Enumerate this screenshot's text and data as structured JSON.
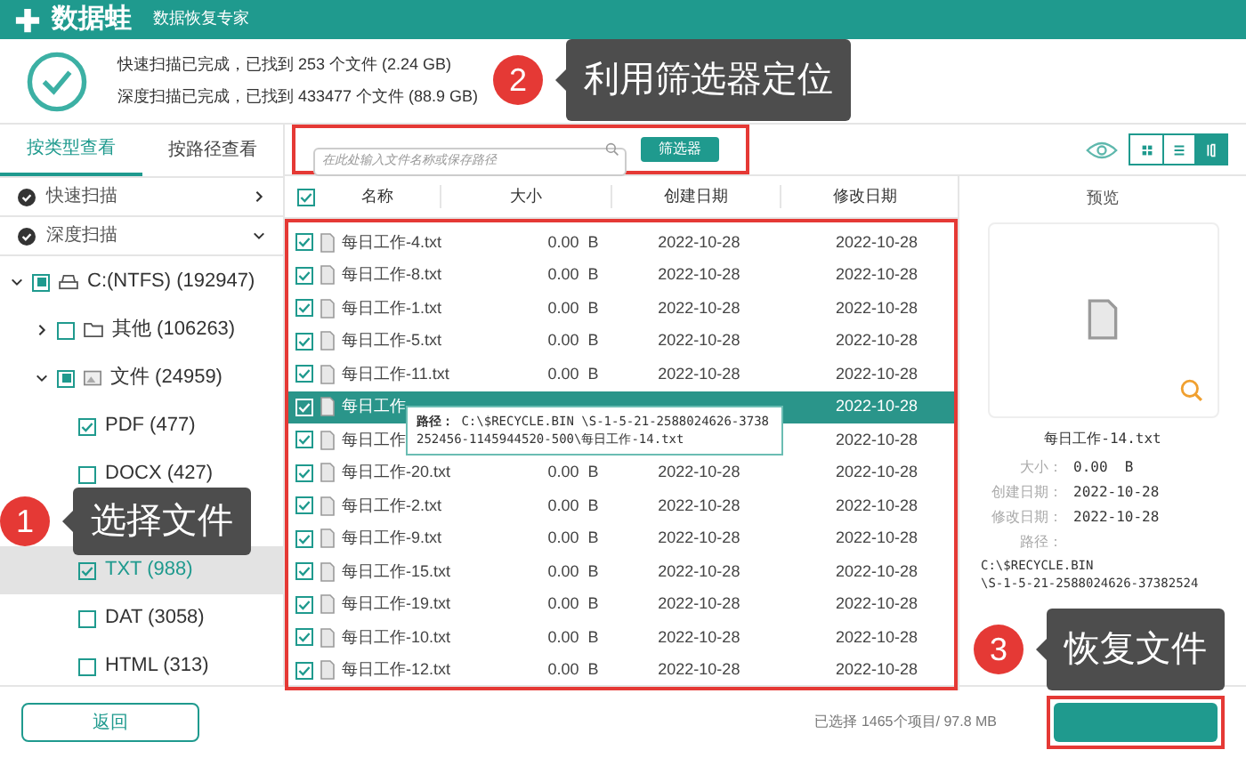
{
  "app": {
    "name": "数据蛙",
    "subtitle": "数据恢复专家"
  },
  "scan_summary": [
    "快速扫描已完成，已找到 253 个文件 (2.24 GB)",
    "深度扫描已完成，已找到 433477 个文件 (88.9 GB)"
  ],
  "view_tabs": [
    {
      "label": "按类型查看",
      "selected": true
    },
    {
      "label": "按路径查看",
      "selected": false
    }
  ],
  "scan_modes": [
    {
      "label": "快速扫描",
      "expanded": false
    },
    {
      "label": "深度扫描",
      "expanded": true
    }
  ],
  "tree": [
    {
      "label": "C:(NTFS) (192947)",
      "kind": "drive",
      "partial": true,
      "expanded": true,
      "selected": false,
      "children": [
        {
          "label": "其他 (106263)",
          "kind": "folder",
          "checked": false,
          "expanded": false,
          "selected": false
        },
        {
          "label": "文件 (24959)",
          "kind": "files",
          "partial": true,
          "expanded": true,
          "selected": false,
          "children": [
            {
              "label": "PDF (477)",
              "checked": true,
              "selected": false
            },
            {
              "label": "DOCX (427)",
              "checked": false,
              "selected": false
            },
            {
              "selected": false
            },
            {
              "label": "TXT (988)",
              "checked": true,
              "selected": true
            },
            {
              "label": "DAT (3058)",
              "checked": false,
              "selected": false
            },
            {
              "label": "HTML (313)",
              "checked": false,
              "selected": false
            }
          ]
        }
      ]
    }
  ],
  "search": {
    "placeholder": "在此处输入文件名称或保存路径"
  },
  "filter_button": "筛选器",
  "view_modes": [
    {
      "kind": "grid",
      "selected": false
    },
    {
      "kind": "list",
      "selected": false
    },
    {
      "kind": "detail",
      "selected": true
    }
  ],
  "table": {
    "all_checked": true,
    "columns": [
      "名称",
      "大小",
      "创建日期",
      "修改日期"
    ],
    "rows": [
      {
        "name": "每日工作-4.txt",
        "size": "0.00  B",
        "created": "2022-10-28",
        "modified": "2022-10-28",
        "checked": true,
        "selected": false
      },
      {
        "name": "每日工作-8.txt",
        "size": "0.00  B",
        "created": "2022-10-28",
        "modified": "2022-10-28",
        "checked": true,
        "selected": false
      },
      {
        "name": "每日工作-1.txt",
        "size": "0.00  B",
        "created": "2022-10-28",
        "modified": "2022-10-28",
        "checked": true,
        "selected": false
      },
      {
        "name": "每日工作-5.txt",
        "size": "0.00  B",
        "created": "2022-10-28",
        "modified": "2022-10-28",
        "checked": true,
        "selected": false
      },
      {
        "name": "每日工作-11.txt",
        "size": "0.00  B",
        "created": "2022-10-28",
        "modified": "2022-10-28",
        "checked": true,
        "selected": false
      },
      {
        "name": "每日工作",
        "modified": "2022-10-28",
        "checked": true,
        "selected": true
      },
      {
        "name": "每日工作",
        "modified": "2022-10-28",
        "checked": true,
        "selected": false
      },
      {
        "name": "每日工作-20.txt",
        "size": "0.00  B",
        "created": "2022-10-28",
        "modified": "2022-10-28",
        "checked": true,
        "selected": false
      },
      {
        "name": "每日工作-2.txt",
        "size": "0.00  B",
        "created": "2022-10-28",
        "modified": "2022-10-28",
        "checked": true,
        "selected": false
      },
      {
        "name": "每日工作-9.txt",
        "size": "0.00  B",
        "created": "2022-10-28",
        "modified": "2022-10-28",
        "checked": true,
        "selected": false
      },
      {
        "name": "每日工作-15.txt",
        "size": "0.00  B",
        "created": "2022-10-28",
        "modified": "2022-10-28",
        "checked": true,
        "selected": false
      },
      {
        "name": "每日工作-19.txt",
        "size": "0.00  B",
        "created": "2022-10-28",
        "modified": "2022-10-28",
        "checked": true,
        "selected": false
      },
      {
        "name": "每日工作-10.txt",
        "size": "0.00  B",
        "created": "2022-10-28",
        "modified": "2022-10-28",
        "checked": true,
        "selected": false
      },
      {
        "name": "每日工作-12.txt",
        "size": "0.00  B",
        "created": "2022-10-28",
        "modified": "2022-10-28",
        "checked": true,
        "selected": false
      }
    ]
  },
  "tooltip": {
    "label": "路径：",
    "path": "C:\\$RECYCLE.BIN \\S-1-5-21-2588024626-3738252456-1145944520-500\\每日工作-14.txt"
  },
  "preview": {
    "title": "预览",
    "file_name": "每日工作-14.txt",
    "details": [
      {
        "label": "大小：",
        "value": "0.00  B"
      },
      {
        "label": "创建日期：",
        "value": "2022-10-28"
      },
      {
        "label": "修改日期：",
        "value": "2022-10-28"
      }
    ],
    "path_label": "路径：",
    "path_lines": [
      "C:\\$RECYCLE.BIN",
      "\\S-1-5-21-2588024626-37382524"
    ]
  },
  "back_button": "返回",
  "status": "已选择 1465个项目/ 97.8 MB",
  "callouts": [
    {
      "number": "1",
      "text": "选择文件"
    },
    {
      "number": "2",
      "text": "利用筛选器定位"
    },
    {
      "number": "3",
      "text": "恢复文件"
    }
  ]
}
